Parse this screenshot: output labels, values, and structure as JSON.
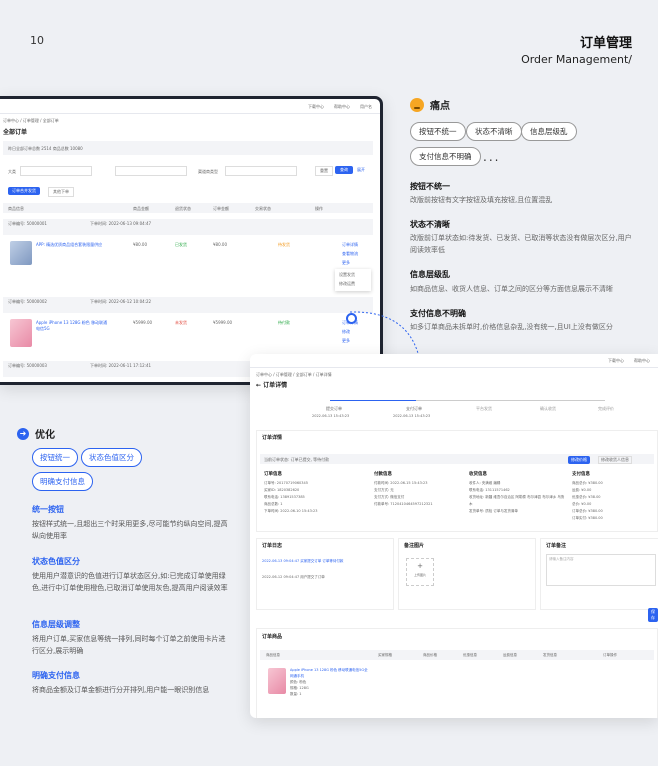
{
  "page": {
    "number": "10",
    "title_zh": "订单管理",
    "title_en": "Order Management/"
  },
  "pain": {
    "heading": "痛点",
    "tags": [
      "按钮不统一",
      "状态不清晰",
      "信息层级乱",
      "支付信息不明确"
    ],
    "more": "...",
    "points": [
      {
        "title": "按钮不统一",
        "desc": "改版前按钮有文字按钮及填充按钮,且位置混乱"
      },
      {
        "title": "状态不清晰",
        "desc": "改版前订单状态如:待发货、已发货、已取消等状态没有做层次区分,用户阅读效率低"
      },
      {
        "title": "信息层级乱",
        "desc": "如商品信息、收货人信息、订单之间的区分等方面信息展示不清晰"
      },
      {
        "title": "支付信息不明确",
        "desc": "如多订单商品未拆单时,价格信息杂乱,没有统一,且UI上没有做区分"
      }
    ]
  },
  "optimize": {
    "heading": "优化",
    "tags": [
      "按钮统一",
      "状态色值区分",
      "明确支付信息"
    ],
    "points": [
      {
        "title": "统一按钮",
        "desc": "按钮样式统一,且超出三个时采用更多,尽可能节约纵向空间,提高纵向使用率"
      },
      {
        "title": "状态色值区分",
        "desc": "使用用户潜意识的色值进行订单状态区分,如:已完成订单使用绿色,进行中订单使用橙色,已取消订单使用灰色,提高用户阅读效率"
      },
      {
        "title": "信息层级调整",
        "desc": "将用户订单,买家信息等统一排列,同时每个订单之前使用卡片进行区分,展示明确"
      },
      {
        "title": "明确支付信息",
        "desc": "将商品金额及订单金额进行分开排列,用户能一眼识别信息"
      }
    ]
  },
  "shot1": {
    "top_links": [
      "下载中心",
      "帮助中心",
      "用户名"
    ],
    "breadcrumb": "订单中心 / 订单管理 / 全部订单",
    "title": "全部订单",
    "stats": "昨日全部订单总数 2514    商品总数 10080",
    "filters": [
      "大类",
      "全部",
      "渠道商类型",
      "请选择"
    ],
    "buttons": [
      "订单合并发货",
      "其他下单",
      "重置",
      "查询",
      "展开"
    ],
    "columns": [
      "商品信息",
      "商品金额",
      "退货状态",
      "订单金额",
      "交易状态",
      "操作"
    ],
    "orders": [
      {
        "id": "订单编号: 50000001",
        "time": "下单时间: 2022-06-13 09:04:47",
        "product": "APP: 精选优质商品组合套装限量供应",
        "price": "¥80.00",
        "status": "已发货",
        "total": "¥80.00",
        "trade": "待发货",
        "ops": [
          "订单详情",
          "查看物流",
          "更多"
        ]
      },
      {
        "id": "订单编号: 50000002",
        "time": "下单时间: 2022-06-12 10:04:22",
        "product": "Apple iPhone 13 128G 粉色 移动联通电信5G",
        "price": "¥5999.00",
        "status": "未发货",
        "total": "¥5999.00",
        "trade": "待付款",
        "ops": [
          "订单详情",
          "修改",
          "更多"
        ]
      },
      {
        "id": "订单编号: 50000003",
        "time": "下单时间: 2022-06-11 17:12:41",
        "product": "",
        "price": "",
        "status": "",
        "total": "",
        "trade": "",
        "ops": []
      }
    ],
    "menu": [
      "设置发货",
      "修改运费"
    ]
  },
  "shot2": {
    "top_links": [
      "下载中心",
      "帮助中心"
    ],
    "breadcrumb": "订单中心 / 订单管理 / 全部订单 / 订单详情",
    "title": "订单详情",
    "steps": [
      "提交订单",
      "支付订单",
      "平台发货",
      "确认收货",
      "完成评价"
    ],
    "step_times": [
      "2022-06-13 15:43:23",
      "2022-06-13 15:43:23"
    ],
    "detail_title": "订单详情",
    "status_line": "当前订单状态: 订单已提交, 等待付款",
    "actions": [
      "修改价格",
      "修改收货人信息",
      "修改"
    ],
    "cols": [
      "订单信息",
      "付款信息",
      "收货信息",
      "支付信息"
    ],
    "order_info": [
      "订单号: 20170719060345",
      "买家ID: 1820382620",
      "联系电话: 13891537385",
      "商品总数: 1",
      "下单时间: 2022-06-10 15:43:23"
    ],
    "pay_info": [
      "付款时间: 2022-06-15 15:43:23",
      "支付方式: 无",
      "支付方式: 微信支付",
      "付款单号: 7120410464597212321"
    ],
    "recv_info": [
      "收件人: 夹满维 编辑",
      "联系电话: 13111571462",
      "收货地址: 新疆 维吾尔自治区 阿勒泰 布尔津县 布尔津乡 乌鲁木",
      "发货单号: 质检 订单与发货清单"
    ],
    "sum_info": [
      "商品总价: ¥380.00",
      "运费: ¥0.00",
      "优惠总价: ¥38.00",
      "总价: ¥0.00",
      "订单总价: ¥380.00",
      "订单实付: ¥380.00"
    ],
    "log_title": "订单日志",
    "logs": [
      "2022-06-13 09:04:47 买家提交订单 订单等待付款",
      "2022-06-12 09:04:47 用户提交了订单"
    ],
    "note_title": "备注图片",
    "upload": "上传图片",
    "remark_title": "订单备注",
    "remark_ph": "请输入备注内容",
    "save": "保存",
    "goods_title": "订单商品",
    "goods_cols": [
      "商品信息",
      "买家规格",
      "商品价格",
      "优惠信息",
      "运费信息",
      "发货信息",
      "订单操作"
    ],
    "goods": [
      "Apple iPhone 13 128G 粉色 移动联通电信5G全网通手机",
      "颜色: 粉色",
      "规格: 128G",
      "数量: 1"
    ]
  }
}
